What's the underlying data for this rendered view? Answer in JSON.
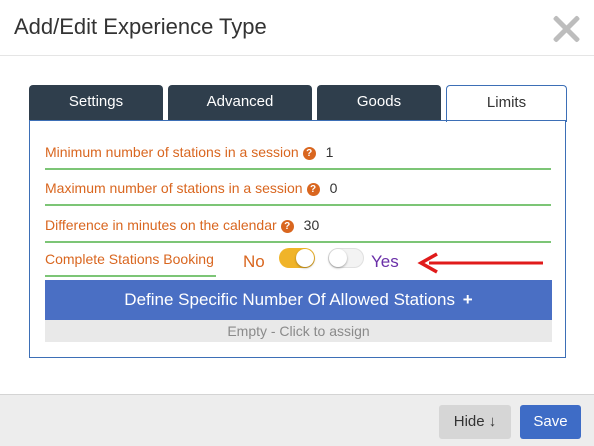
{
  "modal": {
    "title": "Add/Edit Experience Type"
  },
  "tabs": [
    {
      "label": "Settings",
      "active": false
    },
    {
      "label": "Advanced",
      "active": false
    },
    {
      "label": "Goods",
      "active": false
    },
    {
      "label": "Limits",
      "active": true
    }
  ],
  "limits": {
    "min_stations": {
      "label": "Minimum number of stations in a session",
      "value": "1"
    },
    "max_stations": {
      "label": "Maximum number of stations in a session",
      "value": "0"
    },
    "diff_minutes": {
      "label": "Difference in minutes on the calendar",
      "value": "30"
    },
    "complete_booking": {
      "label": "Complete Stations Booking",
      "no_label": "No",
      "yes_label": "Yes",
      "no_toggle_on": true,
      "yes_toggle_on": false
    },
    "define_button": "Define Specific Number Of Allowed Stations",
    "define_plus": "+",
    "empty_text": "Empty - Click to assign"
  },
  "footer": {
    "hide_label": "Hide",
    "hide_arrow": "↓",
    "save_label": "Save"
  },
  "help_glyph": "?",
  "colors": {
    "tab_dark": "#2f3e4c",
    "accent_blue": "#3d6fb6",
    "label_orange": "#d9661f",
    "underline_green": "#7cc576",
    "toggle_on": "#f0b429",
    "yes_purple": "#6a2fa8",
    "annotation_arrow": "#e01b1b"
  }
}
